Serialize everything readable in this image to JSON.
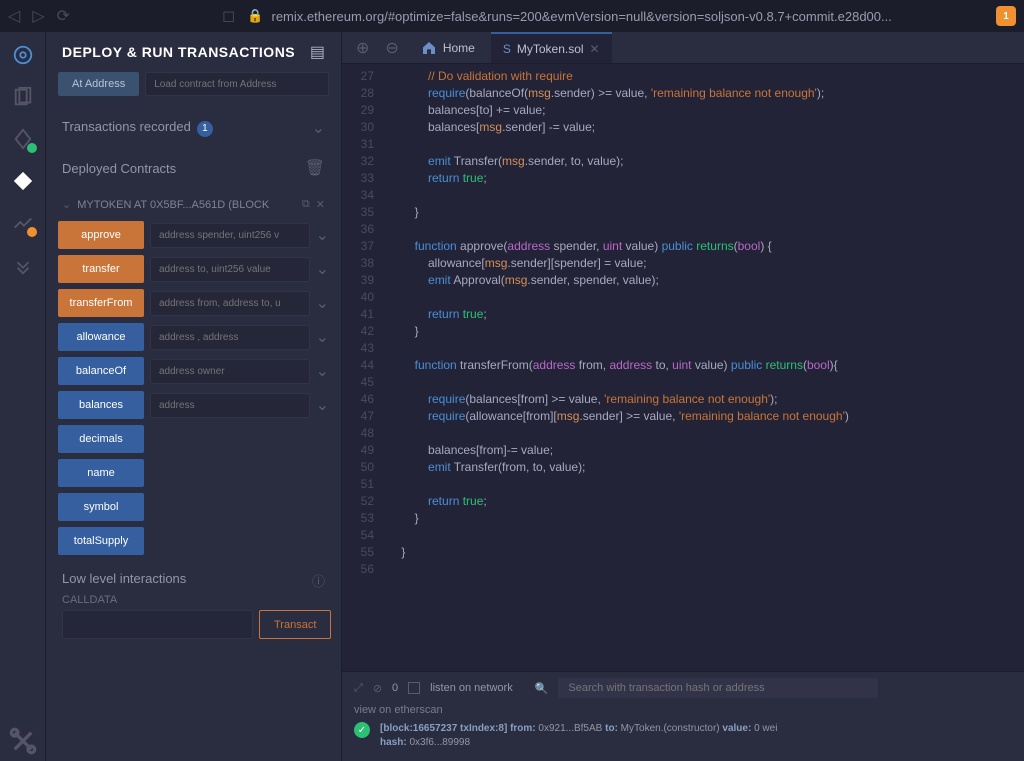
{
  "browser": {
    "url": "remix.ethereum.org/#optimize=false&runs=200&evmVersion=null&version=soljson-v0.8.7+commit.e28d00...",
    "shield_badge": "1"
  },
  "panel": {
    "title": "DEPLOY & RUN TRANSACTIONS",
    "at_address_btn": "At Address",
    "at_address_placeholder": "Load contract from Address",
    "tx_recorded_label": "Transactions recorded",
    "tx_recorded_count": "1",
    "deployed_label": "Deployed Contracts",
    "contract_name": "MYTOKEN AT 0X5BF...A561D (BLOCK",
    "functions": [
      {
        "name": "approve",
        "placeholder": "address spender, uint256 v",
        "color": "orange",
        "hasInput": true
      },
      {
        "name": "transfer",
        "placeholder": "address to, uint256 value",
        "color": "orange",
        "hasInput": true
      },
      {
        "name": "transferFrom",
        "placeholder": "address from, address to, u",
        "color": "orange",
        "hasInput": true
      },
      {
        "name": "allowance",
        "placeholder": "address , address",
        "color": "blue",
        "hasInput": true
      },
      {
        "name": "balanceOf",
        "placeholder": "address owner",
        "color": "blue",
        "hasInput": true
      },
      {
        "name": "balances",
        "placeholder": "address",
        "color": "blue",
        "hasInput": true
      },
      {
        "name": "decimals",
        "placeholder": "",
        "color": "blue",
        "hasInput": false
      },
      {
        "name": "name",
        "placeholder": "",
        "color": "blue",
        "hasInput": false
      },
      {
        "name": "symbol",
        "placeholder": "",
        "color": "blue",
        "hasInput": false
      },
      {
        "name": "totalSupply",
        "placeholder": "",
        "color": "blue",
        "hasInput": false
      }
    ],
    "low_level_title": "Low level interactions",
    "calldata_label": "CALLDATA",
    "transact_btn": "Transact"
  },
  "tabs": {
    "home": "Home",
    "file": "MyToken.sol"
  },
  "code_lines": [
    {
      "n": 27,
      "html": "            <span class='str'>// Do validation with require</span>"
    },
    {
      "n": 28,
      "html": "            <span class='kw'>require</span>(balanceOf(<span class='msg'>msg</span>.sender) >= value, <span class='str'>'remaining balance not enough'</span>);"
    },
    {
      "n": 29,
      "html": "            balances[to] += value;"
    },
    {
      "n": 30,
      "html": "            balances[<span class='msg'>msg</span>.sender] -= value;"
    },
    {
      "n": 31,
      "html": ""
    },
    {
      "n": 32,
      "html": "            <span class='kw'>emit</span> Transfer(<span class='msg'>msg</span>.sender, to, value);"
    },
    {
      "n": 33,
      "html": "            <span class='kw'>return</span> <span class='bool'>true</span>;"
    },
    {
      "n": 34,
      "html": ""
    },
    {
      "n": 35,
      "html": "        }"
    },
    {
      "n": 36,
      "html": ""
    },
    {
      "n": 37,
      "html": "        <span class='kw'>function</span> <span class='fn'>approve</span>(<span class='type'>address</span> spender, <span class='type'>uint</span> value) <span class='kw'>public</span> <span class='ret'>returns</span>(<span class='type'>bool</span>) {"
    },
    {
      "n": 38,
      "html": "            allowance[<span class='msg'>msg</span>.sender][spender] = value;"
    },
    {
      "n": 39,
      "html": "            <span class='kw'>emit</span> Approval(<span class='msg'>msg</span>.sender, spender, value);"
    },
    {
      "n": 40,
      "html": ""
    },
    {
      "n": 41,
      "html": "            <span class='kw'>return</span> <span class='bool'>true</span>;"
    },
    {
      "n": 42,
      "html": "        }"
    },
    {
      "n": 43,
      "html": ""
    },
    {
      "n": 44,
      "html": "        <span class='kw'>function</span> <span class='fn'>transferFrom</span>(<span class='type'>address</span> from, <span class='type'>address</span> to, <span class='type'>uint</span> value) <span class='kw'>public</span> <span class='ret'>returns</span>(<span class='type'>bool</span>){"
    },
    {
      "n": 45,
      "html": ""
    },
    {
      "n": 46,
      "html": "            <span class='kw'>require</span>(balances[from] >= value, <span class='str'>'remaining balance not enough'</span>);"
    },
    {
      "n": 47,
      "html": "            <span class='kw'>require</span>(allowance[from][<span class='msg'>msg</span>.sender] >= value, <span class='str'>'remaining balance not enough'</span>)"
    },
    {
      "n": 48,
      "html": ""
    },
    {
      "n": 49,
      "html": "            balances[from]-= value;"
    },
    {
      "n": 50,
      "html": "            <span class='kw'>emit</span> Transfer(from, to, value);"
    },
    {
      "n": 51,
      "html": ""
    },
    {
      "n": 52,
      "html": "            <span class='kw'>return</span> <span class='bool'>true</span>;"
    },
    {
      "n": 53,
      "html": "        }"
    },
    {
      "n": 54,
      "html": ""
    },
    {
      "n": 55,
      "html": "    }"
    },
    {
      "n": 56,
      "html": ""
    }
  ],
  "terminal": {
    "pending": "0",
    "listen_label": "listen on network",
    "search_placeholder": "Search with transaction hash or address",
    "view_label": "view on etherscan",
    "log_line1": "[block:16657237 txIndex:8] from: 0x921...Bf5AB to: MyToken.(constructor) value: 0 wei",
    "log_line2": "hash: 0x3f6...89998"
  }
}
